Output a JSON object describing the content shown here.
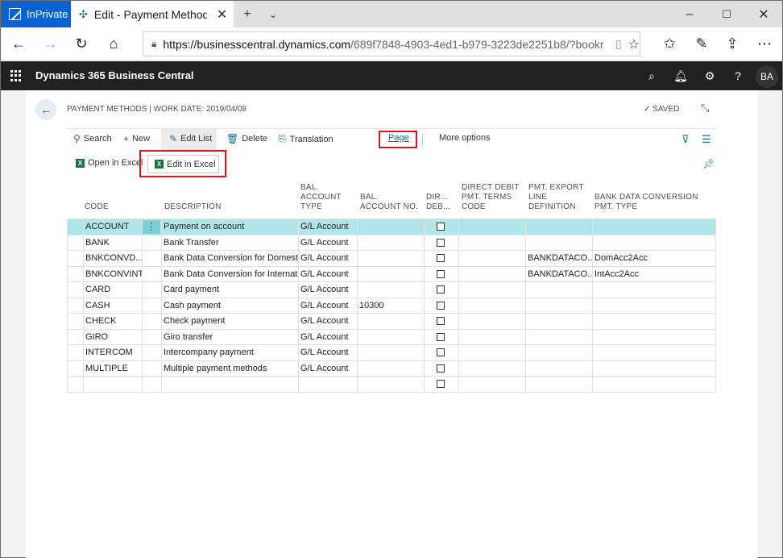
{
  "browser": {
    "inprivate_label": "InPrivate",
    "tab_title": "Edit - Payment Methods",
    "url_host": "https://businesscentral.dynamics.com",
    "url_path": "/689f7848-4903-4ed1-b979-3223de2251b8/?bookr"
  },
  "appbar": {
    "brand": "Dynamics 365 Business Central",
    "avatar": "BA"
  },
  "page": {
    "caption": "PAYMENT METHODS | WORK DATE: 2019/04/08",
    "saved": "SAVED"
  },
  "actions": {
    "search": "Search",
    "new": "New",
    "edit_list": "Edit List",
    "delete": "Delete",
    "translation": "Translation",
    "page": "Page",
    "more_options": "More options",
    "open_in_excel": "Open in Excel",
    "edit_in_excel": "Edit in Excel"
  },
  "table": {
    "headers": {
      "code": "CODE",
      "description": "DESCRIPTION",
      "bal_type_1": "BAL.",
      "bal_type_2": "ACCOUNT",
      "bal_type_3": "TYPE",
      "bal_no_1": "BAL.",
      "bal_no_2": "ACCOUNT NO.",
      "dir_1": "DIR...",
      "dir_2": "DEB...",
      "dd_1": "DIRECT DEBIT",
      "dd_2": "PMT. TERMS",
      "dd_3": "CODE",
      "pe_1": "PMT. EXPORT",
      "pe_2": "LINE",
      "pe_3": "DEFINITION",
      "bd_1": "BANK DATA CONVERSION",
      "bd_2": "PMT. TYPE"
    },
    "rows": [
      {
        "code": "ACCOUNT",
        "description": "Payment on account",
        "type": "G/L Account",
        "no": "",
        "export": "",
        "conv": ""
      },
      {
        "code": "BANK",
        "description": "Bank Transfer",
        "type": "G/L Account",
        "no": "",
        "export": "",
        "conv": ""
      },
      {
        "code": "BNKCONVD...",
        "description": "Bank Data Conversion for Domest...",
        "type": "G/L Account",
        "no": "",
        "export": "BANKDATACO...",
        "conv": "DomAcc2Acc"
      },
      {
        "code": "BNKCONVINT",
        "description": "Bank Data Conversion for Internat...",
        "type": "G/L Account",
        "no": "",
        "export": "BANKDATACO...",
        "conv": "IntAcc2Acc"
      },
      {
        "code": "CARD",
        "description": "Card payment",
        "type": "G/L Account",
        "no": "",
        "export": "",
        "conv": ""
      },
      {
        "code": "CASH",
        "description": "Cash payment",
        "type": "G/L Account",
        "no": "10300",
        "export": "",
        "conv": ""
      },
      {
        "code": "CHECK",
        "description": "Check payment",
        "type": "G/L Account",
        "no": "",
        "export": "",
        "conv": ""
      },
      {
        "code": "GIRO",
        "description": "Giro transfer",
        "type": "G/L Account",
        "no": "",
        "export": "",
        "conv": ""
      },
      {
        "code": "INTERCOM",
        "description": "Intercompany payment",
        "type": "G/L Account",
        "no": "",
        "export": "",
        "conv": ""
      },
      {
        "code": "MULTIPLE",
        "description": "Multiple payment methods",
        "type": "G/L Account",
        "no": "",
        "export": "",
        "conv": ""
      },
      {
        "code": "",
        "description": "",
        "type": "",
        "no": "",
        "export": "",
        "conv": ""
      }
    ]
  },
  "colors": {
    "inprivate": "#0a62d2",
    "appbar": "#212121",
    "selected_row": "#b2e5e8",
    "highlight_box": "#d4181f",
    "accent": "#1a6a8f"
  }
}
